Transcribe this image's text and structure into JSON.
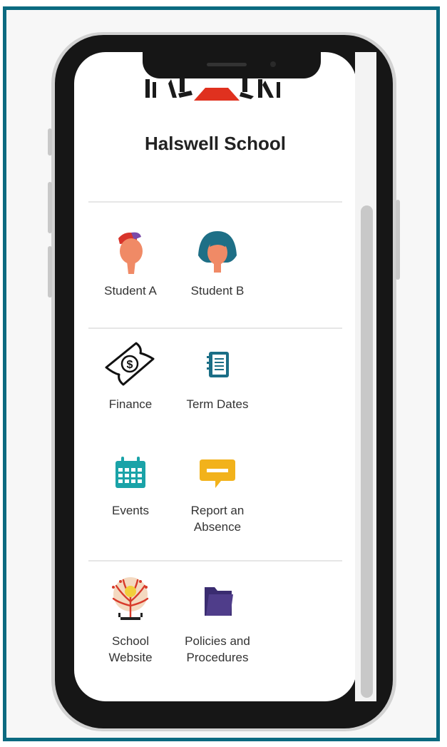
{
  "school": {
    "name": "Halswell School"
  },
  "sections": [
    {
      "items": [
        {
          "label": "Student A",
          "icon": "student-a-avatar-icon"
        },
        {
          "label": "Student B",
          "icon": "student-b-avatar-icon"
        }
      ]
    },
    {
      "items": [
        {
          "label": "Finance",
          "icon": "money-icon"
        },
        {
          "label": "Term Dates",
          "icon": "notebook-icon"
        },
        {
          "label": "Events",
          "icon": "calendar-icon"
        },
        {
          "label": "Report an\nAbsence",
          "icon": "chat-bubble-icon"
        }
      ]
    },
    {
      "items": [
        {
          "label": "School\nWebsite",
          "icon": "school-tree-logo-icon"
        },
        {
          "label": "Policies and\nProcedures",
          "icon": "folder-icon"
        }
      ]
    }
  ],
  "colors": {
    "frame_border": "#0b6a80",
    "calendar": "#1aa3a8",
    "chat": "#f2b21b",
    "folder": "#4f3d8a",
    "avatar_cap": "#7a4aa8",
    "avatar_hair": "#1e6f86"
  }
}
